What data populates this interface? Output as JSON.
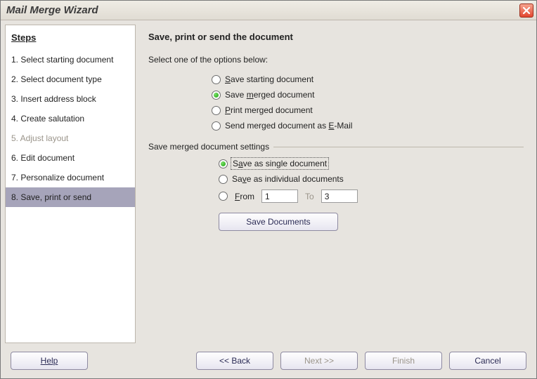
{
  "window": {
    "title": "Mail Merge Wizard"
  },
  "sidebar": {
    "header": "Steps",
    "items": [
      {
        "label": "1. Select starting document",
        "state": "normal"
      },
      {
        "label": "2. Select document type",
        "state": "normal"
      },
      {
        "label": "3. Insert address block",
        "state": "normal"
      },
      {
        "label": "4. Create salutation",
        "state": "normal"
      },
      {
        "label": "5. Adjust layout",
        "state": "disabled"
      },
      {
        "label": "6. Edit document",
        "state": "normal"
      },
      {
        "label": "7. Personalize document",
        "state": "normal"
      },
      {
        "label": "8.  Save, print or send",
        "state": "active"
      }
    ]
  },
  "main": {
    "heading": "Save, print or send the document",
    "prompt": "Select one of the options below:",
    "options": {
      "save_starting": {
        "pre": "",
        "key": "S",
        "post": "ave starting document",
        "checked": false
      },
      "save_merged": {
        "pre": "Save ",
        "key": "m",
        "post": "erged document",
        "checked": true
      },
      "print_merged": {
        "pre": "",
        "key": "P",
        "post": "rint merged document",
        "checked": false
      },
      "send_email": {
        "pre": "Send merged document as ",
        "key": "E",
        "post": "-Mail",
        "checked": false
      }
    },
    "settings_title": "Save merged document settings",
    "settings": {
      "single": {
        "pre": "S",
        "key": "a",
        "post": "ve as single document",
        "checked": true,
        "focused": true
      },
      "individual": {
        "pre": "Sa",
        "key": "v",
        "post": "e as individual documents",
        "checked": false
      },
      "from": {
        "pre": "",
        "key": "F",
        "post": "rom",
        "checked": false
      },
      "from_value": "1",
      "to_label": "To",
      "to_value": "3"
    },
    "save_button": "Save Documents"
  },
  "footer": {
    "help": "Help",
    "back": "<< Back",
    "next": "Next >>",
    "finish": "Finish",
    "cancel": "Cancel"
  }
}
